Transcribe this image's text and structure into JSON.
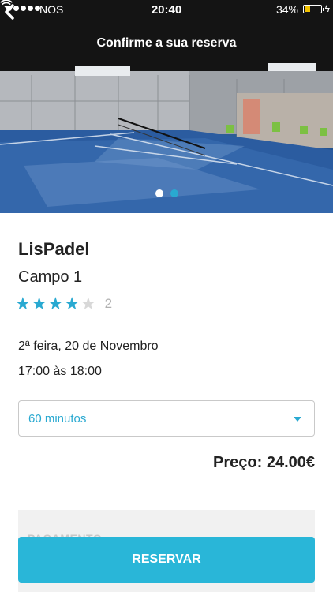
{
  "status_bar": {
    "carrier": "NOS",
    "time": "20:40",
    "battery_percent": "34%",
    "battery_level": 0.34
  },
  "header": {
    "title": "Confirme a sua reserva",
    "back_icon": "chevron-left-icon"
  },
  "carousel": {
    "image_description_icon": "padel-court-photo",
    "page_count": 2,
    "active_index": 1,
    "dot_colors": {
      "inactive": "#ffffff",
      "active": "#29a9d1"
    }
  },
  "venue": {
    "name": "LisPadel",
    "court": "Campo 1",
    "rating": 4,
    "rating_max": 5,
    "review_count": "2"
  },
  "booking": {
    "date": "2ª feira, 20 de Novembro",
    "time_range": "17:00 às 18:00",
    "duration_selected": "60 minutos"
  },
  "price": {
    "label": "Preço:",
    "value": "24.00€"
  },
  "payment": {
    "label": "PAGAMENTO"
  },
  "actions": {
    "reserve_label": "RESERVAR"
  },
  "colors": {
    "accent": "#29a9d1",
    "button": "#29b6d8",
    "star_filled": "#29a9d1",
    "star_empty": "#d8d8d8"
  }
}
